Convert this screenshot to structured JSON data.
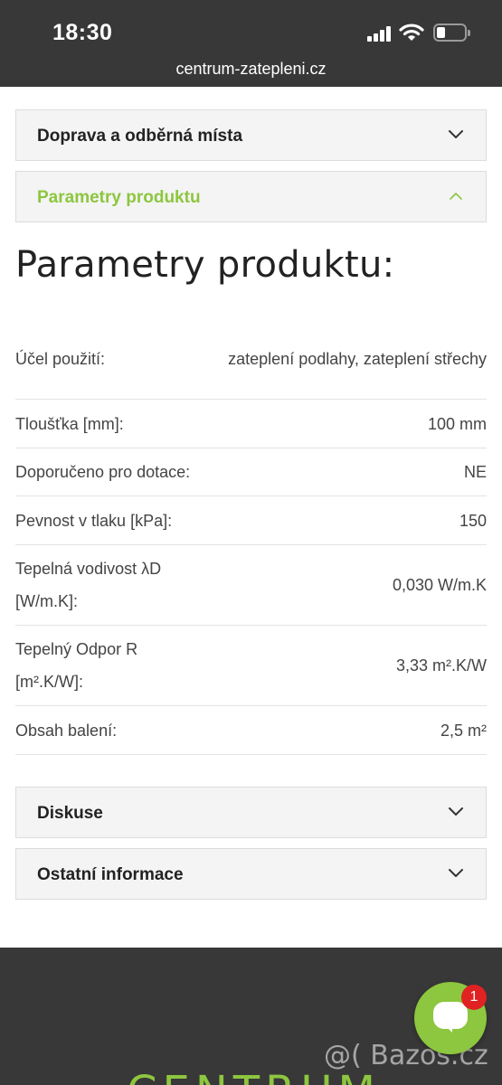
{
  "status_bar": {
    "time": "18:30"
  },
  "browser": {
    "url": "centrum-zatepleni.cz"
  },
  "accordions_top": [
    {
      "label": "Doprava a odběrná místa",
      "icon": "chevron-down-icon"
    },
    {
      "label": "Parametry produktu",
      "icon": "chevron-up-icon",
      "active": true
    }
  ],
  "section": {
    "title": "Parametry produktu:"
  },
  "parameters": [
    {
      "key": "Účel použití:",
      "value": "zateplení podlahy, zateplení střechy"
    },
    {
      "key": "Tloušťka [mm]:",
      "value": "100 mm"
    },
    {
      "key": "Doporučeno pro dotace:",
      "value": "NE"
    },
    {
      "key": "Pevnost v tlaku [kPa]:",
      "value": "150"
    },
    {
      "key": "Tepelná vodivost λD [W/m.K]:",
      "value": "0,030 W/m.K"
    },
    {
      "key": "Tepelný Odpor R [m².K/W]:",
      "value": "3,33 m².K/W"
    },
    {
      "key": "Obsah balení:",
      "value": "2,5 m²"
    }
  ],
  "accordions_bottom": [
    {
      "label": "Diskuse",
      "icon": "chevron-down-icon"
    },
    {
      "label": "Ostatní informace",
      "icon": "chevron-down-icon"
    }
  ],
  "footer": {
    "brand": "CENTRUM"
  },
  "chat": {
    "badge": "1"
  },
  "watermark": "@( Bazos.cz",
  "colors": {
    "accent": "#8dc63f",
    "dark": "#383838",
    "panel": "#f4f4f4",
    "badge": "#e02222"
  }
}
